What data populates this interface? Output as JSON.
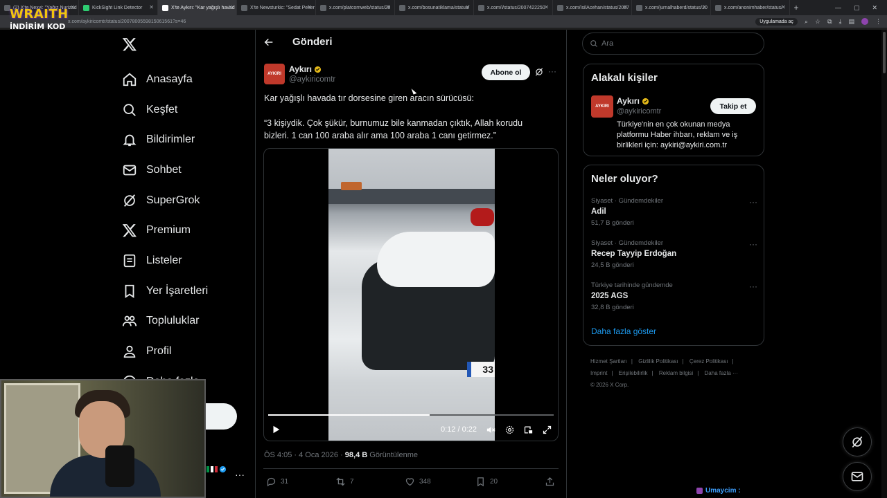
{
  "browser": {
    "tabs": [
      {
        "label": "(2) X'te Nexyi: \"Yağız Nurizad"
      },
      {
        "label": "KickSight Link Detector"
      },
      {
        "label": "X'te Aykırı: \"Kar yağışlı havad"
      },
      {
        "label": "X'te Newsturkic: \"Sedat Peker"
      },
      {
        "label": "x.com/platcomweb/status/20"
      },
      {
        "label": "x.com/bosunatiklama/status/"
      },
      {
        "label": "x.com/i/status/2007422250"
      },
      {
        "label": "x.com/IsilAcehan/status/2007"
      },
      {
        "label": "x.com/jurnalhaberd/status/20"
      },
      {
        "label": "x.com/anonimhaber/status/"
      }
    ],
    "url": "x.com/aykiricomtr/status/2007800559815061561?s=46",
    "open_in_app": "Uygulamada aç"
  },
  "overlay": {
    "brand": "WRAITH",
    "brand_sub": "İNDİRİM KOD",
    "chat_user": "Umaycim :"
  },
  "nav": {
    "items": [
      {
        "label": "Anasayfa",
        "icon": "home-icon"
      },
      {
        "label": "Keşfet",
        "icon": "search-icon"
      },
      {
        "label": "Bildirimler",
        "icon": "bell-icon"
      },
      {
        "label": "Sohbet",
        "icon": "mail-icon"
      },
      {
        "label": "SuperGrok",
        "icon": "grok-icon"
      },
      {
        "label": "Premium",
        "icon": "x-icon"
      },
      {
        "label": "Listeler",
        "icon": "list-icon"
      },
      {
        "label": "Yer İşaretleri",
        "icon": "bookmark-icon"
      },
      {
        "label": "Topluluklar",
        "icon": "people-icon"
      },
      {
        "label": "Profil",
        "icon": "user-icon"
      },
      {
        "label": "Daha fazla",
        "icon": "more-circle-icon"
      }
    ],
    "post_button": "a"
  },
  "post": {
    "header": "Gönderi",
    "author": {
      "name": "Aykırı",
      "handle": "@aykiricomtr",
      "avatar_text": "AYKIRI"
    },
    "subscribe": "Abone ol",
    "text_line1": "Kar yağışlı havada tır dorsesine giren aracın sürücüsü:",
    "text_line2": "“3 kişiydik. Çok şükür, burnumuz bile kanmadan çıktık, Allah korudu bizleri. 1 can 100 araba alır ama 100 araba 1 canı getirmez.”",
    "video": {
      "time": "0:12 / 0:22",
      "progress": 0.565,
      "plate_text": "33"
    },
    "timestamp": "ÖS 4:05 · 4 Oca 2026 · ",
    "views": "98,4 B",
    "views_label": " Görüntülenme",
    "stats": {
      "replies": "31",
      "reposts": "7",
      "likes": "348",
      "bookmarks": "20"
    }
  },
  "sidebar": {
    "search_placeholder": "Ara",
    "related": {
      "title": "Alakalı kişiler",
      "name": "Aykırı",
      "handle": "@aykiricomtr",
      "follow": "Takip et",
      "bio": "Türkiye'nin en çok okunan medya platformu Haber ihbarı, reklam ve iş birlikleri için: aykiri@aykiri.com.tr",
      "avatar_text": "AYKIRI"
    },
    "trends": {
      "title": "Neler oluyor?",
      "items": [
        {
          "meta": "Siyaset · Gündemdekiler",
          "name": "Adil",
          "count": "51,7 B gönderi"
        },
        {
          "meta": "Siyaset · Gündemdekiler",
          "name": "Recep Tayyip Erdoğan",
          "count": "24,5 B gönderi"
        },
        {
          "meta": "Türkiye tarihinde gündemde",
          "name": "2025 AGS",
          "count": "32,8 B gönderi"
        }
      ],
      "show_more": "Daha fazla göster"
    },
    "footer": {
      "links": [
        "Hizmet Şartları",
        "Gizlilik Politikası",
        "Çerez Politikası",
        "Imprint",
        "Erişilebilirlik",
        "Reklam bilgisi",
        "Daha fazla ···"
      ],
      "copyright": "© 2026 X Corp."
    }
  },
  "colors": {
    "accent": "#1d9bf0",
    "background": "#000000",
    "border": "#2f3336",
    "muted": "#71767b",
    "verified": "#e2b719"
  }
}
